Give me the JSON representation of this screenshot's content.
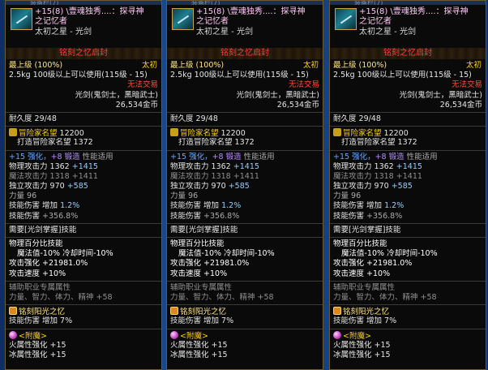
{
  "header_strip": "装备栏(7)",
  "tooltip": {
    "name_line1": "+15(8) \\壹魂独秀....：探寻神",
    "name_line2": "之记忆者",
    "subtitle": "太初之星 - 光剑",
    "seal": "铭刻之忆启封",
    "grade": "最上级",
    "grade_pct": "(100%)",
    "rarity": "太初",
    "weight_level": "2.5kg   100级以上可以使用(115级 - 15)",
    "trade": "无法交易",
    "type": "光剑(鬼剑士，黑暗武士)",
    "price": "26,534金币",
    "durability": "耐久度 29/48",
    "adv_fame_label": "冒险家名望",
    "adv_fame": "12200",
    "forge_fame_label": "打造冒险家名望",
    "forge_fame": "1372",
    "enhance_line_a": "+15 强化，",
    "enhance_line_b": "+8 锻造",
    "enhance_line_c": "性能适用",
    "phys_atk_label": "物理攻击力",
    "phys_atk": "1362",
    "phys_atk_bonus": "+1415",
    "mag_atk_label": "魔法攻击力",
    "mag_atk": "1318",
    "mag_atk_bonus": "+1411",
    "ind_atk_label": "独立攻击力",
    "ind_atk": "970",
    "ind_atk_bonus": "+585",
    "str_line": "力量 96",
    "skill_dmg_label": "技能伤害",
    "skill_dmg_inc": "增加",
    "skill_dmg_val": "1.2%",
    "skill_dmg_extra": "+356.8%",
    "mastery": "需要[光剑掌握]技能",
    "phys_pct_title": "物理百分比技能",
    "mp_cd": "魔法值-10% 冷却时间-10%",
    "atk_boost": "攻击强化 +21981.0%",
    "atk_speed": "攻击速度 +10%",
    "support_title": "辅助职业专属属性",
    "support_stats": "力量、智力、体力、精神 +58",
    "emblem_title": "铭刻阳光之忆",
    "emblem_skill": "技能伤害 增加 7%",
    "enchant_title": "<附魔>",
    "fire_boost": "火属性强化 +15",
    "ice_boost": "冰属性强化 +15"
  }
}
